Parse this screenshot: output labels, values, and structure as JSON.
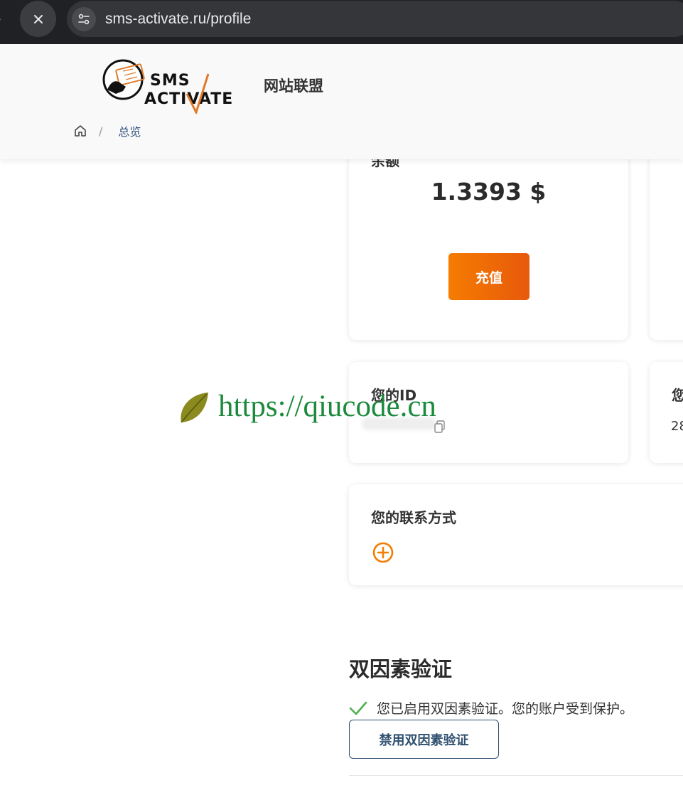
{
  "browser": {
    "url": "sms-activate.ru/profile"
  },
  "header": {
    "logo_text_top": "SMS",
    "logo_text_bottom": "ACTIVATE",
    "affiliate_label": "网站联盟",
    "breadcrumb": {
      "separator": "/",
      "current": "总览"
    }
  },
  "balance": {
    "title": "余额",
    "value": "1.3393 $",
    "topup_label": "充值"
  },
  "id_card": {
    "title": "您的ID"
  },
  "right_card": {
    "title_partial": "您",
    "value_partial": "28"
  },
  "contacts": {
    "title": "您的联系方式"
  },
  "twofa": {
    "heading": "双因素验证",
    "status": "您已启用双因素验证。您的账户受到保护。",
    "disable_label": "禁用双因素验证"
  },
  "watermark": {
    "text": "https://qiucode.cn"
  },
  "colors": {
    "accent_orange": "#f57c00",
    "link_blue": "#2f4f7f",
    "success_green": "#4caf50",
    "watermark_green": "#1c8a3c"
  }
}
